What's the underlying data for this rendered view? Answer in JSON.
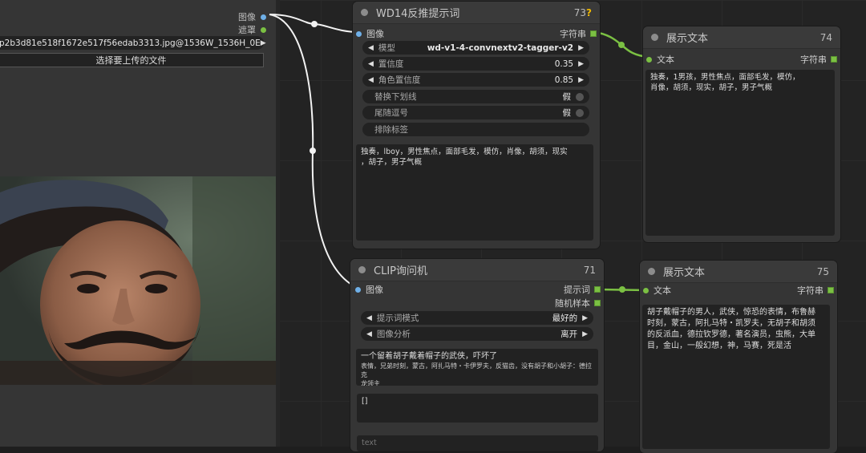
{
  "load_node": {
    "out_image": "图像",
    "out_mask": "遮罩",
    "filename": "p2b3d81e518f1672e517f56edab3313.jpg@1536W_1536H_0E",
    "upload_button": "选择要上传的文件"
  },
  "wd14": {
    "title": "WD14反推提示词",
    "id": "73",
    "badge": "?",
    "in_image": "图像",
    "out_string": "字符串",
    "widgets": [
      {
        "label": "模型",
        "value": "wd-v1-4-convnextv2-tagger-v2"
      },
      {
        "label": "置信度",
        "value": "0.35"
      },
      {
        "label": "角色置信度",
        "value": "0.85"
      }
    ],
    "toggles": [
      {
        "label": "替换下划线",
        "value": "假"
      },
      {
        "label": "尾随逗号",
        "value": "假"
      }
    ],
    "exclude_label": "排除标签",
    "output_text": "独奏，lboy，男性焦点，面部毛发，模仿，肖像，胡须，现实\n，胡子，男子气概"
  },
  "show74": {
    "title": "展示文本",
    "id": "74",
    "in_text": "文本",
    "out_string": "字符串",
    "text": "独奏，1男孩，男性焦点，面部毛发，模仿，\n肖像，胡须，现实，胡子，男子气概"
  },
  "clip": {
    "title": "CLIP询问机",
    "id": "71",
    "in_image": "图像",
    "out_prompt": "提示词",
    "out_sample": "随机样本",
    "widgets": [
      {
        "label": "提示词模式",
        "value": "最好的"
      },
      {
        "label": "图像分析",
        "value": "离开"
      }
    ],
    "text_line1": "一个留着胡子戴着帽子的武侠，吓坏了",
    "text_line2": "表情，兄弟时刻，蒙古，阿扎马特・卡伊罗夫，反猫齿，没有胡子和小胡子：德拉克\n龙领主",
    "box2_text": "[]",
    "box3_text": "text"
  },
  "show75": {
    "title": "展示文本",
    "id": "75",
    "in_text": "文本",
    "out_string": "字符串",
    "text": "胡子戴帽子的男人，武侠，惊恐的表情，布鲁赫\n时刻，蒙古，阿扎马特・凯罗夫，无胡子和胡须\n的反派血，德拉钦罗德，著名演员，虫熊，大单\n目，金山，一般幻想，神，马赛，死是活"
  },
  "colors": {
    "image_pin": "#6fb0e8",
    "string_pin": "#7bc043",
    "wire": "#f2f2f2"
  }
}
